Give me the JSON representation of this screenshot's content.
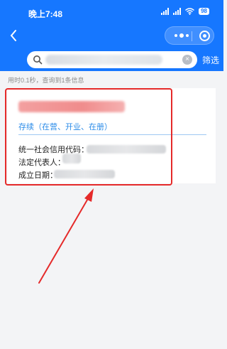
{
  "status_bar": {
    "time": "晚上7:48",
    "battery": "98"
  },
  "nav": {
    "back_icon": "chevron-left-icon",
    "more_icon": "more-dots-icon",
    "close_icon": "target-circle-icon"
  },
  "search": {
    "value": "",
    "filter_label": "筛选"
  },
  "result_stat": "用时0.1秒，查询到1条信息",
  "card": {
    "status": "存续（在营、开业、在册）",
    "fields": [
      {
        "label": "统一社会信用代码："
      },
      {
        "label": "法定代表人："
      },
      {
        "label": "成立日期："
      }
    ]
  },
  "colors": {
    "header_blue": "#1677ff",
    "status_blue": "#2a8be8",
    "highlight_red": "#e52a2a"
  }
}
